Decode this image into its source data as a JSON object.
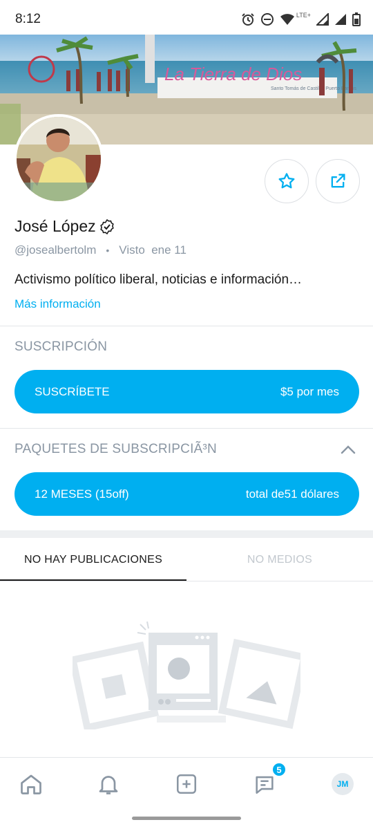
{
  "status_bar": {
    "time": "8:12",
    "network_label": "LTE+"
  },
  "cover": {
    "sign_text": "La Tierra de Dios",
    "sign_subtext": "Santo Tomás de Castilla, Puerto Barrios"
  },
  "profile": {
    "name": "José López",
    "handle": "@josealbertolm",
    "separator": "•",
    "last_seen": "Visto  ene 11",
    "bio": "Activismo político liberal, noticias e información…",
    "more_info_link": "Más información"
  },
  "subscription": {
    "title": "SUSCRIPCIÓN",
    "button_label": "SUSCRÍBETE",
    "button_price": "$5 por mes"
  },
  "bundles": {
    "title": "PAQUETES DE SUBSCRIPCIÃ³N",
    "button_label": "12 MESES (15off)",
    "button_price": "total de51 dólares"
  },
  "tabs": [
    {
      "label": "NO HAY PUBLICACIONES",
      "active": true
    },
    {
      "label": "NO MEDIOS",
      "active": false
    }
  ],
  "bottom_nav": {
    "messages_badge": "5",
    "avatar_initials": "JM"
  },
  "colors": {
    "accent": "#00aff0",
    "muted": "#8a96a3",
    "text": "#1a1a1a"
  },
  "icons": [
    "alarm-icon",
    "do-not-disturb-icon",
    "wifi-icon",
    "signal-icon",
    "battery-icon",
    "verified-icon",
    "star-icon",
    "share-icon",
    "chevron-up-icon",
    "home-icon",
    "bell-icon",
    "add-icon",
    "messages-icon"
  ]
}
